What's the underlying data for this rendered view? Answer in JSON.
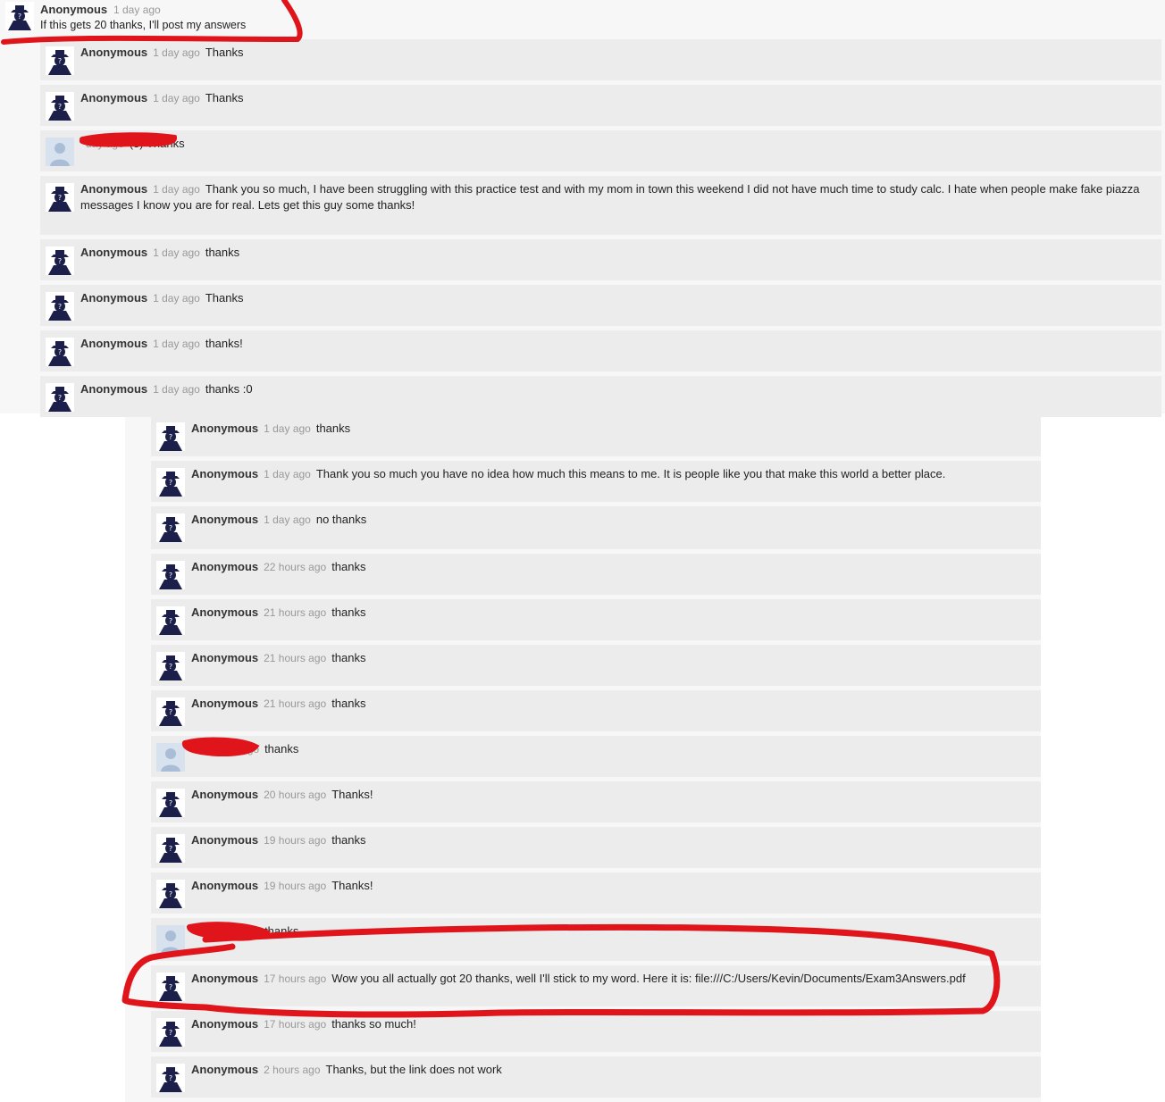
{
  "thread": {
    "original_post": {
      "author": "Anonymous",
      "time": "1 day ago",
      "text": "If this gets 20 thanks, I'll post my answers",
      "avatar_icon": "anonymous-spy-avatar-icon"
    },
    "replies_top": [
      {
        "author": "Anonymous",
        "time": "1 day ago",
        "text": "Thanks",
        "avatar": "anon"
      },
      {
        "author": "Anonymous",
        "time": "1 day ago",
        "text": "Thanks",
        "avatar": "anon"
      },
      {
        "author": "",
        "time": "day ago",
        "text": "(3) Thanks",
        "avatar": "user"
      },
      {
        "author": "Anonymous",
        "time": "1 day ago",
        "text": "Thank you so much, I have been struggling with this practice test and with my mom in town this weekend I did not have much time to study calc. I hate when people make fake piazza messages I know you are for real. Lets get this guy some thanks!",
        "avatar": "anon"
      },
      {
        "author": "Anonymous",
        "time": "1 day ago",
        "text": "thanks",
        "avatar": "anon"
      },
      {
        "author": "Anonymous",
        "time": "1 day ago",
        "text": "Thanks",
        "avatar": "anon"
      },
      {
        "author": "Anonymous",
        "time": "1 day ago",
        "text": "thanks!",
        "avatar": "anon"
      },
      {
        "author": "Anonymous",
        "time": "1 day ago",
        "text": "thanks :0",
        "avatar": "anon"
      }
    ],
    "replies_bottom": [
      {
        "author": "Anonymous",
        "time": "1 day ago",
        "text": "thanks",
        "avatar": "anon"
      },
      {
        "author": "Anonymous",
        "time": "1 day ago",
        "text": "Thank you so much you have no idea how much this means to me. It is people like you that make this world a better place.",
        "avatar": "anon"
      },
      {
        "author": "Anonymous",
        "time": "1 day ago",
        "text": "no thanks",
        "avatar": "anon"
      },
      {
        "author": "Anonymous",
        "time": "22 hours ago",
        "text": "thanks",
        "avatar": "anon"
      },
      {
        "author": "Anonymous",
        "time": "21 hours ago",
        "text": "thanks",
        "avatar": "anon"
      },
      {
        "author": "Anonymous",
        "time": "21 hours ago",
        "text": "thanks",
        "avatar": "anon"
      },
      {
        "author": "Anonymous",
        "time": "21 hours ago",
        "text": "thanks",
        "avatar": "anon"
      },
      {
        "author": "",
        "time": "20 hours ago",
        "text": "thanks",
        "avatar": "user"
      },
      {
        "author": "Anonymous",
        "time": "20 hours ago",
        "text": "Thanks!",
        "avatar": "anon"
      },
      {
        "author": "Anonymous",
        "time": "19 hours ago",
        "text": "thanks",
        "avatar": "anon"
      },
      {
        "author": "Anonymous",
        "time": "19 hours ago",
        "text": "Thanks!",
        "avatar": "anon"
      },
      {
        "author": "",
        "time": "18 hours ago",
        "text": "thanks",
        "avatar": "user"
      },
      {
        "author": "Anonymous",
        "time": "17 hours ago",
        "text": "Wow you all actually got 20 thanks, well I'll stick to my word. Here it is: file:///C:/Users/Kevin/Documents/Exam3Answers.pdf",
        "avatar": "anon"
      },
      {
        "author": "Anonymous",
        "time": "17 hours ago",
        "text": "thanks so much!",
        "avatar": "anon"
      },
      {
        "author": "Anonymous",
        "time": "2 hours ago",
        "text": "Thanks, but the link does not work",
        "avatar": "anon"
      }
    ]
  },
  "colors": {
    "reply_bg": "#ececec",
    "panel_bg": "#f7f7f7",
    "avatar_navy": "#1b1f4a",
    "avatar_user_bg": "#c9d7e8",
    "annotation_red": "#e0141b"
  },
  "annotations": {
    "redaction_marks": "red scribbles over usernames",
    "highlight_marks": "red hand-drawn underline and circle"
  }
}
